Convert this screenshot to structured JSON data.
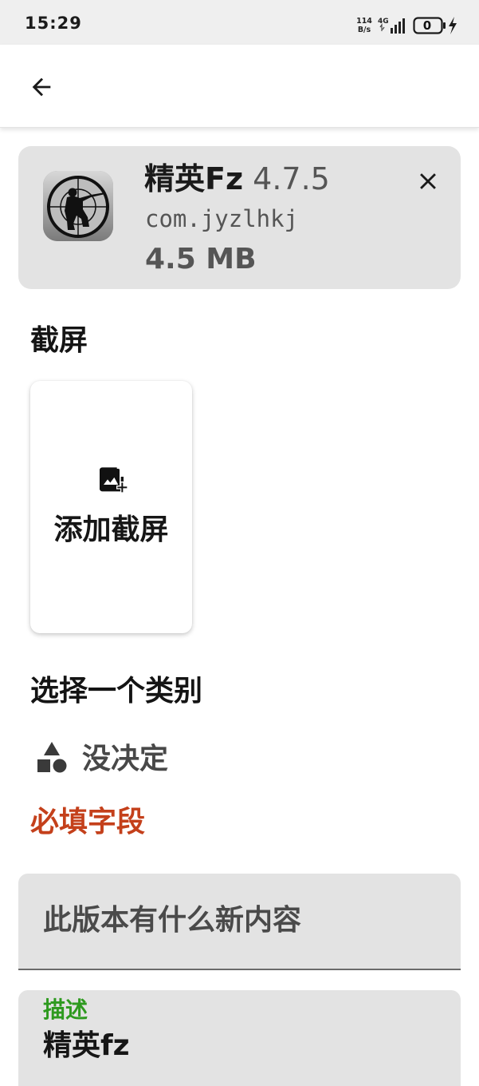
{
  "status_bar": {
    "time": "15:29",
    "net_speed_value": "114",
    "net_speed_unit": "B/s",
    "network_type": "4G",
    "battery_level": "0"
  },
  "app_bar": {
    "back_icon": "arrow-back-icon"
  },
  "app_card": {
    "icon": "soldier-crosshair-app-icon",
    "name": "精英Fz",
    "version": "4.7.5",
    "package": "com.jyzlhkj",
    "size": "4.5 MB",
    "close_icon": "close-icon"
  },
  "screenshots": {
    "title": "截屏",
    "add_label": "添加截屏",
    "add_icon": "add-photo-icon"
  },
  "category": {
    "title": "选择一个类别",
    "value": "没决定",
    "icon": "category-shapes-icon",
    "required_text": "必填字段"
  },
  "whats_new": {
    "placeholder": "此版本有什么新内容"
  },
  "description": {
    "label": "描述",
    "value": "精英fz"
  },
  "colors": {
    "card_background": "#e3e3e3",
    "required": "#c4401b",
    "field_label_focus": "#2e9a1f"
  }
}
